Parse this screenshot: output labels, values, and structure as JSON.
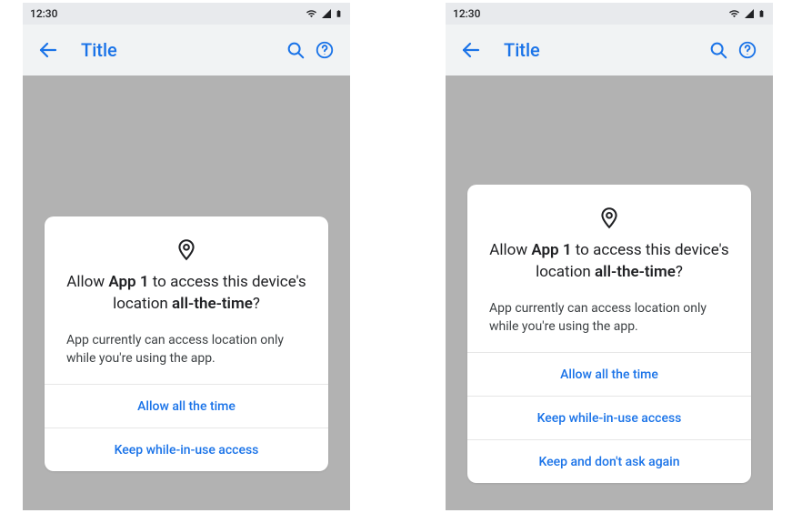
{
  "status": {
    "time": "12:30"
  },
  "appbar": {
    "title": "Title"
  },
  "dialog": {
    "title_pre": "Allow ",
    "title_app": "App 1",
    "title_mid": " to access this device's location ",
    "title_bold2": "all-the-time",
    "title_post": "?",
    "body": "App currently can access location only while you're using the app."
  },
  "options_left": [
    "Allow all the time",
    "Keep while-in-use access"
  ],
  "options_right": [
    "Allow all the time",
    "Keep while-in-use access",
    "Keep and don't ask again"
  ]
}
